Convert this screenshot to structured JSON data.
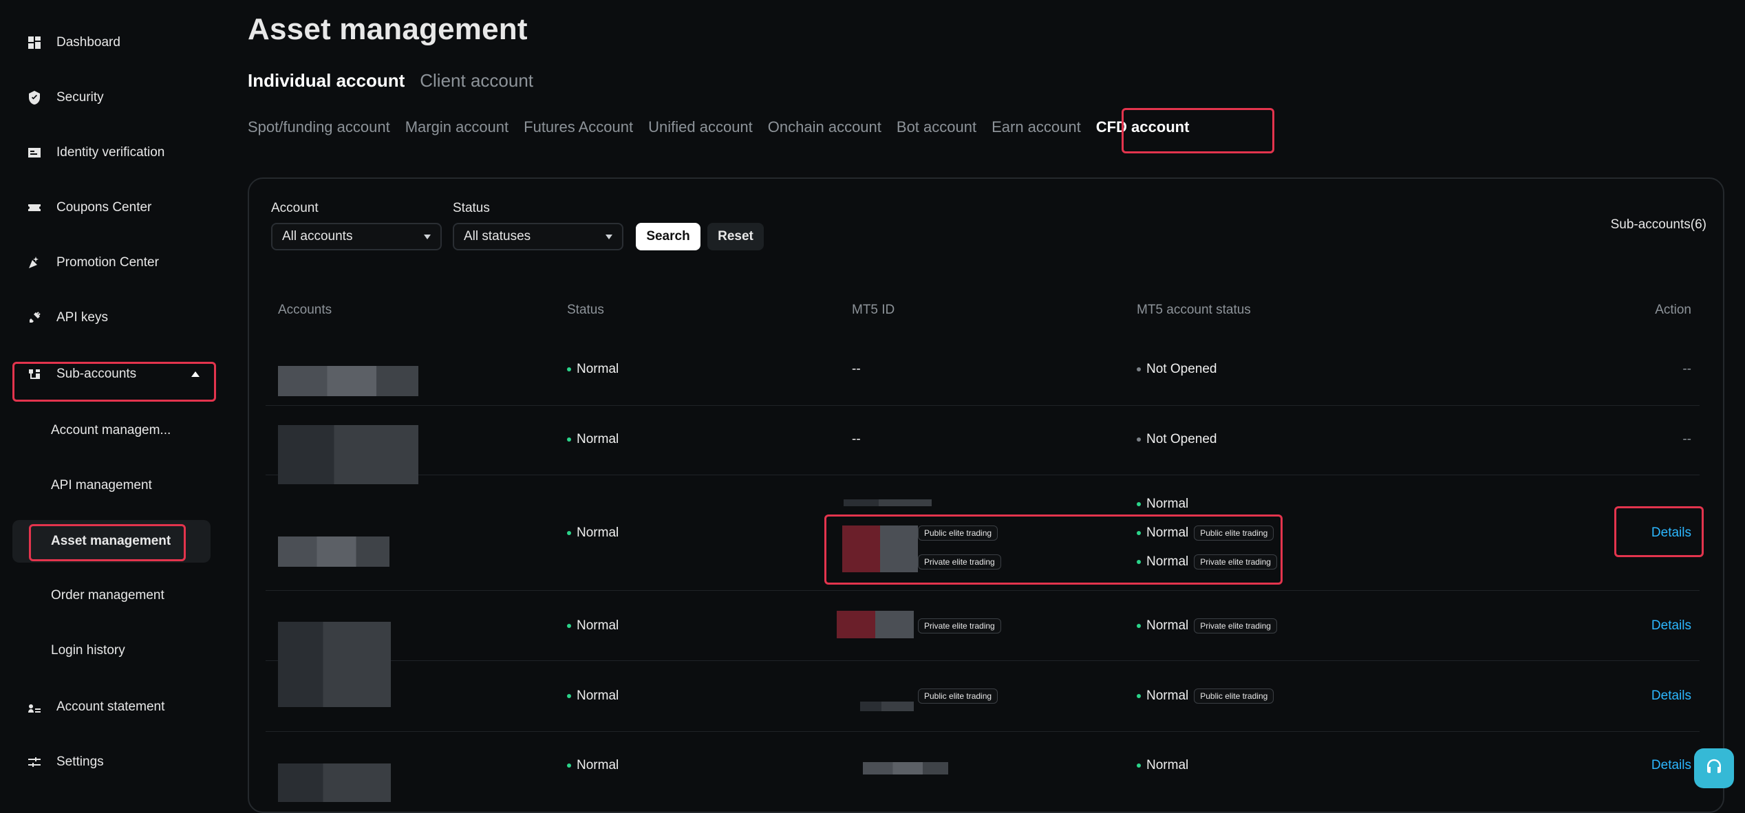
{
  "sidebar": {
    "items": [
      {
        "label": "Dashboard",
        "icon": "grid-icon"
      },
      {
        "label": "Security",
        "icon": "shield-check-icon"
      },
      {
        "label": "Identity verification",
        "icon": "id-card-icon"
      },
      {
        "label": "Coupons Center",
        "icon": "coupon-icon"
      },
      {
        "label": "Promotion Center",
        "icon": "party-popper-icon"
      },
      {
        "label": "API keys",
        "icon": "plug-icon"
      },
      {
        "label": "Sub-accounts",
        "icon": "sub-accounts-icon"
      },
      {
        "label": "Account statement",
        "icon": "user-doc-icon"
      },
      {
        "label": "Settings",
        "icon": "sliders-icon"
      }
    ],
    "sub_items": [
      {
        "label": "Account managem..."
      },
      {
        "label": "API management"
      },
      {
        "label": "Asset management"
      },
      {
        "label": "Order management"
      },
      {
        "label": "Login history"
      }
    ]
  },
  "main": {
    "title": "Asset management",
    "account_tabs": [
      "Individual account",
      "Client account"
    ],
    "type_tabs": [
      "Spot/funding account",
      "Margin account",
      "Futures Account",
      "Unified account",
      "Onchain account",
      "Bot account",
      "Earn account",
      "CFD account"
    ],
    "filters": {
      "account_label": "Account",
      "account_value": "All accounts",
      "status_label": "Status",
      "status_value": "All statuses",
      "search": "Search",
      "reset": "Reset"
    },
    "subaccounts_count": "Sub-accounts(6)",
    "table": {
      "headers": [
        "Accounts",
        "Status",
        "MT5 ID",
        "MT5 account status",
        "Action"
      ],
      "rows": [
        {
          "status": "Normal",
          "mt5_id": "--",
          "mt5_status": "Not Opened",
          "action": "--"
        },
        {
          "status": "Normal",
          "mt5_id": "--",
          "mt5_status": "Not Opened",
          "action": "--"
        },
        {
          "status": "Normal",
          "mt5_id": "",
          "mt5_status_top": "Normal",
          "mt5_entries": [
            {
              "badge": "Public elite trading",
              "status": "Normal"
            },
            {
              "badge": "Private elite trading",
              "status": "Normal"
            }
          ],
          "action": "Details"
        },
        {
          "status": "Normal",
          "mt5_entries": [
            {
              "badge": "Private elite trading",
              "status": "Normal"
            }
          ],
          "action": "Details"
        },
        {
          "status": "Normal",
          "mt5_entries": [
            {
              "badge": "Public elite trading",
              "status": "Normal"
            }
          ],
          "action": "Details"
        },
        {
          "status": "Normal",
          "mt5_status": "Normal",
          "action": "Details"
        }
      ]
    }
  },
  "colors": {
    "highlight": "#e3344d",
    "link": "#2cb7ff",
    "normal_dot": "#2bd48a"
  }
}
